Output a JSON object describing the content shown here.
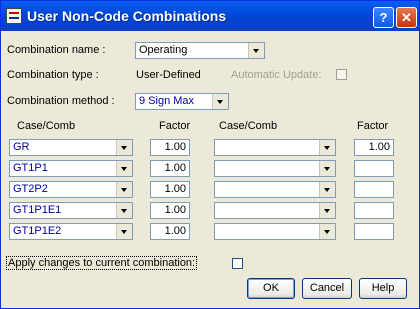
{
  "window": {
    "title": "User Non-Code Combinations",
    "help_glyph": "?",
    "close_glyph": "✕"
  },
  "form": {
    "combination_name_label": "Combination name :",
    "combination_name_value": "Operating",
    "combination_type_label": "Combination type :",
    "combination_type_value": "User-Defined",
    "automatic_update_label": "Automatic Update:",
    "combination_method_label": "Combination method :",
    "combination_method_value": "9 Sign Max"
  },
  "grid": {
    "headers": {
      "case_comb_1": "Case/Comb",
      "factor_1": "Factor",
      "case_comb_2": "Case/Comb",
      "factor_2": "Factor"
    },
    "rows": [
      {
        "case1": "GR",
        "factor1": "1.00",
        "case2": "",
        "factor2": "1.00"
      },
      {
        "case1": "GT1P1",
        "factor1": "1.00",
        "case2": "",
        "factor2": ""
      },
      {
        "case1": "GT2P2",
        "factor1": "1.00",
        "case2": "",
        "factor2": ""
      },
      {
        "case1": "GT1P1E1",
        "factor1": "1.00",
        "case2": "",
        "factor2": ""
      },
      {
        "case1": "GT1P1E2",
        "factor1": "1.00",
        "case2": "",
        "factor2": ""
      }
    ]
  },
  "footer": {
    "apply_label": "Apply changes to current combination:",
    "ok_label": "OK",
    "cancel_label": "Cancel",
    "help_label": "Help"
  }
}
